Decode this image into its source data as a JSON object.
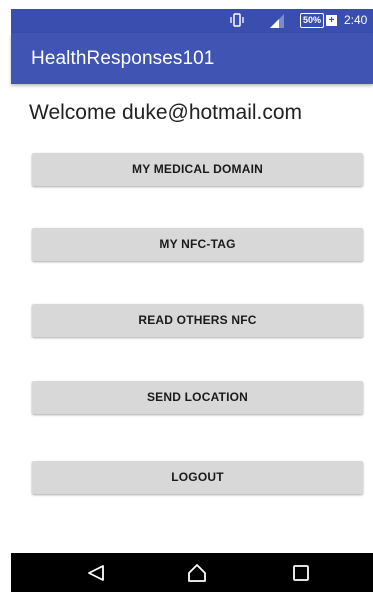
{
  "status_bar": {
    "battery_label": "50%",
    "time": "2:40",
    "icons": [
      "vibrate-icon",
      "signal-icon",
      "battery-icon"
    ]
  },
  "app_bar": {
    "title": "HealthResponses101"
  },
  "welcome_text": "Welcome duke@hotmail.com",
  "buttons": [
    {
      "label": "MY MEDICAL DOMAIN"
    },
    {
      "label": "MY NFC-TAG"
    },
    {
      "label": "READ OTHERS NFC"
    },
    {
      "label": "SEND LOCATION"
    },
    {
      "label": "LOGOUT"
    }
  ],
  "nav_bar": {
    "icons": [
      "back-icon",
      "home-icon",
      "recents-icon"
    ]
  },
  "colors": {
    "primary": "#4054b4",
    "primary_dark": "#3a4eb0",
    "button_bg": "#d8d8d8"
  }
}
